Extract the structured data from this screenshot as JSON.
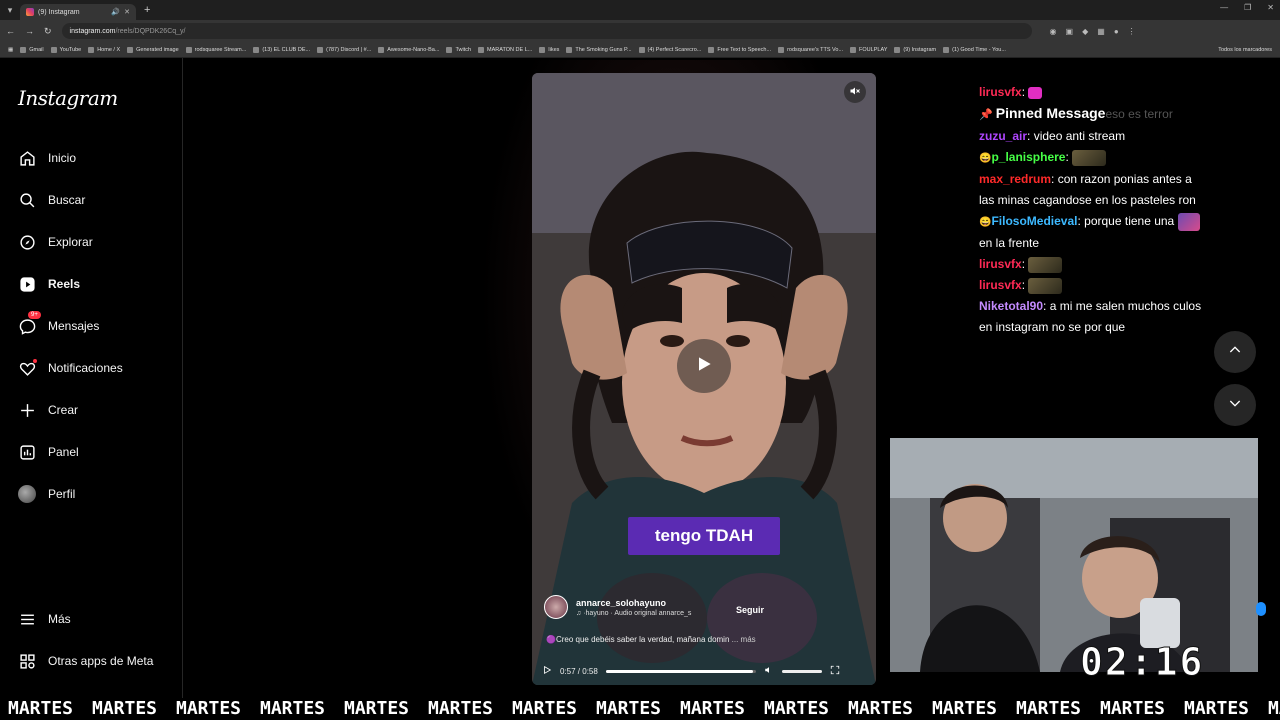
{
  "browser": {
    "tab_title": "(9) Instagram",
    "url_host": "instagram.com",
    "url_path": "/reels/DQPDK26Cq_y/",
    "bookmarks": [
      "Gmail",
      "YouTube",
      "Home / X",
      "Generated image",
      "rodsquaree Stream...",
      "(13) EL CLUB DE...",
      "(787) Discord | #...",
      "Awesome-Nano-Ba...",
      "Twitch",
      "MARATON DE L...",
      "likes",
      "The Smoking Guns P...",
      "(4) Perfect Scarecro...",
      "Free Text to Speech...",
      "rodsquaree's TTS Vo...",
      "FOULPLAY",
      "(9) Instagram",
      "(1) Good Time - You..."
    ],
    "bookmarks_all": "Todos los marcadores"
  },
  "sidebar": {
    "logo": "Instagram",
    "items": [
      {
        "label": "Inicio",
        "icon": "home-icon"
      },
      {
        "label": "Buscar",
        "icon": "search-icon"
      },
      {
        "label": "Explorar",
        "icon": "compass-icon"
      },
      {
        "label": "Reels",
        "icon": "reels-icon"
      },
      {
        "label": "Mensajes",
        "icon": "messenger-icon",
        "badge": "9+"
      },
      {
        "label": "Notificaciones",
        "icon": "heart-icon"
      },
      {
        "label": "Crear",
        "icon": "plus-icon"
      },
      {
        "label": "Panel",
        "icon": "chart-icon"
      },
      {
        "label": "Perfil",
        "icon": "avatar"
      }
    ],
    "more": "Más",
    "meta_apps": "Otras apps de Meta"
  },
  "reel": {
    "caption_overlay": "tengo TDAH",
    "author": "annarce_solohayuno",
    "follow": "Seguir",
    "audio": "·hayuno · Audio original   annarce_s",
    "description": "Creo que debéis saber la verdad, mañana domin",
    "more": "... más",
    "time": "0:57 / 0:58",
    "progress_fraction": 0.98
  },
  "chat": [
    {
      "user": "lirusvfx",
      "color": "#ff2a55",
      "text": "",
      "emote": "pink"
    },
    {
      "pinned": "Pinned Message",
      "faded": "eso es terror"
    },
    {
      "user": "zuzu_air",
      "color": "#b046ff",
      "text": "video anti stream"
    },
    {
      "user": "p_lanisphere",
      "color": "#46ff46",
      "text": "",
      "emote": "emote",
      "badge": "emoji"
    },
    {
      "user": "max_redrum",
      "color": "#ff2a2a",
      "text": "con razon ponias antes a las minas cagandose en los pasteles ron"
    },
    {
      "user": "FilosoMedieval",
      "color": "#3db9ff",
      "text": "porque tiene una",
      "text2": "en la frente",
      "badge": "emoji"
    },
    {
      "user": "lirusvfx",
      "color": "#ff2a55",
      "text": "",
      "emote": "emote"
    },
    {
      "user": "lirusvfx",
      "color": "#ff2a55",
      "text": "",
      "emote": "emote"
    },
    {
      "user": "Niketotal90",
      "color": "#c48bff",
      "text": "a mi me salen muchos culos en instagram no se por que"
    }
  ],
  "stream": {
    "timer": "02:16",
    "marquee": [
      "MARTES",
      "MARTES",
      "MARTES",
      "MARTES",
      "MARTES",
      "MARTES",
      "MARTES",
      "MARTES",
      "MARTES",
      "MARTES",
      "MARTES",
      "MARTES",
      "MARTES",
      "MARTES",
      "MARTES",
      "MARTES"
    ]
  }
}
